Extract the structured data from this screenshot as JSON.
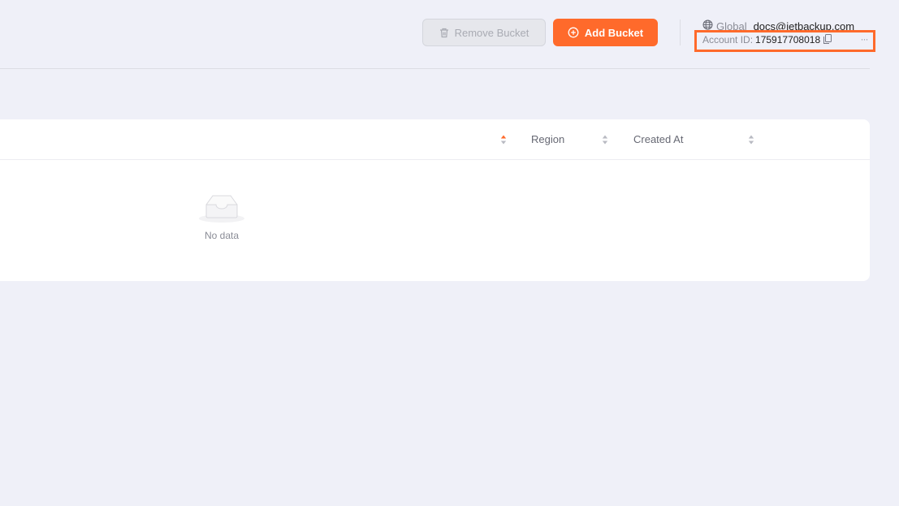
{
  "toolbar": {
    "remove_label": "Remove Bucket",
    "add_label": "Add Bucket"
  },
  "account": {
    "region": "Global",
    "email": "docs@jetbackup.com",
    "id_label": "Account ID:",
    "id_value": "175917708018",
    "more": "···"
  },
  "table": {
    "columns": [
      {
        "label": "",
        "sort": "ascending"
      },
      {
        "label": "Region",
        "sort": "none"
      },
      {
        "label": "Created At",
        "sort": "none"
      }
    ],
    "empty_text": "No data"
  },
  "colors": {
    "accent": "#ff6a2b",
    "background": "#eff0f8",
    "card": "#ffffff"
  },
  "icons": [
    "trash-icon",
    "plus-circle-icon",
    "globe-icon",
    "copy-icon",
    "more-icon",
    "sort-icon",
    "empty-inbox-icon"
  ]
}
